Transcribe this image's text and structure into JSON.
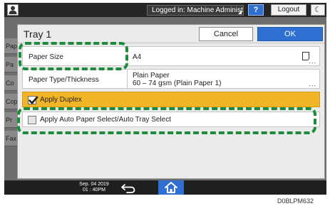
{
  "topbar": {
    "login_status": "Logged in: Machine Administrator",
    "help_label": "?",
    "logout_label": "Logout",
    "night_symbol": "☾"
  },
  "background_tabs": [
    "Pap",
    "Pa",
    "Co",
    "Cop",
    "Pr",
    "Fax"
  ],
  "dialog": {
    "title": "Tray 1",
    "cancel_label": "Cancel",
    "ok_label": "OK",
    "rows": {
      "paper_size": {
        "label": "Paper Size",
        "value": "A4",
        "more": "..."
      },
      "paper_type": {
        "label": "Paper Type/Thickness",
        "value_line1": "Plain Paper",
        "value_line2": "60 – 74 gsm (Plain Paper 1)",
        "more": "..."
      },
      "duplex": {
        "label": "Apply Duplex",
        "checked": true
      },
      "auto_select": {
        "label": "Apply Auto Paper Select/Auto Tray Select",
        "checked": false
      }
    }
  },
  "bottombar": {
    "date": "Sep. 04 2019",
    "time": "01 : 40PM"
  },
  "figure_code": "D0BLPM632",
  "colors": {
    "accent_blue": "#2e6fd1",
    "selected_row": "#f3b528",
    "callout_green": "#1a8c3c"
  },
  "icons": [
    "user-icon",
    "help-icon",
    "night-mode-icon",
    "paper-orientation-icon",
    "check-icon",
    "back-arrow-icon",
    "home-icon"
  ]
}
